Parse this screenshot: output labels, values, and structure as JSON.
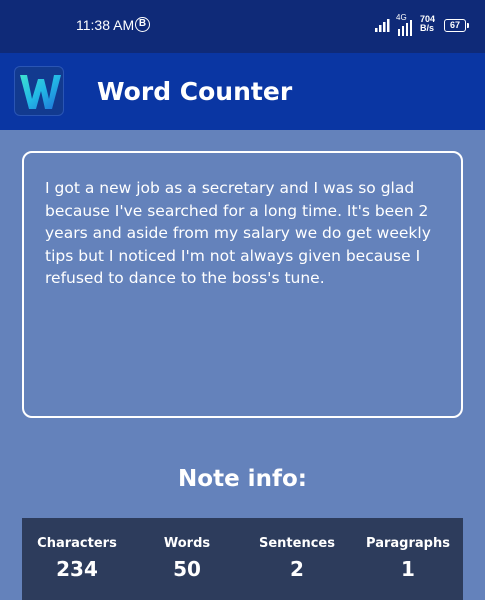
{
  "status_bar": {
    "time": "11:38 AM",
    "b_icon": "B",
    "network": "4G",
    "speed_value": "704",
    "speed_unit": "B/s",
    "battery": "67"
  },
  "app_bar": {
    "title": "Word Counter",
    "logo_icon": "w-logo-icon"
  },
  "note": {
    "text": "I got a new job as a secretary and I was so glad because I've searched for a long time. It's been 2 years and aside from my salary we do get weekly tips but I noticed I'm not always given because I refused to dance to the boss's tune."
  },
  "info": {
    "title": "Note info:",
    "stats": [
      {
        "label": "Characters",
        "value": "234"
      },
      {
        "label": "Words",
        "value": "50"
      },
      {
        "label": "Sentences",
        "value": "2"
      },
      {
        "label": "Paragraphs",
        "value": "1"
      }
    ]
  },
  "colors": {
    "background": "#6482bb",
    "status_bar": "#0f2a78",
    "app_bar": "#0a36a3",
    "stats_panel": "#2d3c5c"
  }
}
